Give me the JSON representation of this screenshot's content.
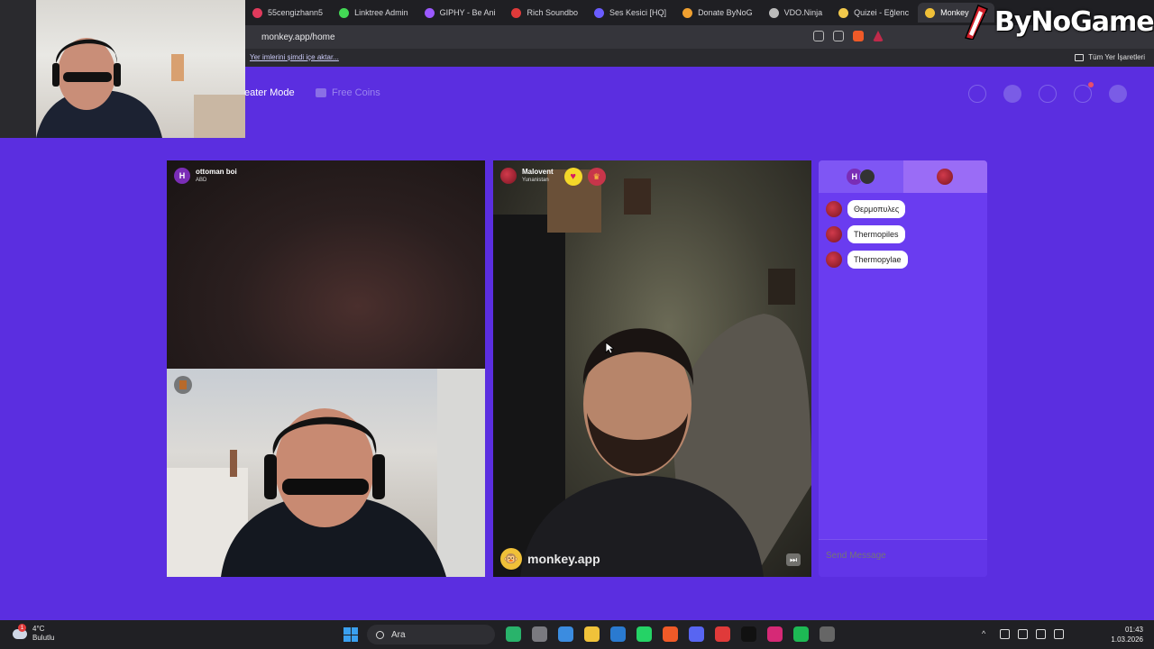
{
  "browser": {
    "tabs": [
      {
        "label": "55cengizhann5",
        "color": "#e03a5c"
      },
      {
        "label": "Linktree Admin",
        "color": "#43d855"
      },
      {
        "label": "GIPHY - Be Ani",
        "color": "#9b59ff"
      },
      {
        "label": "Rich Soundbo",
        "color": "#e03a3a"
      },
      {
        "label": "Ses Kesici [HQ]",
        "color": "#6a5cff"
      },
      {
        "label": "Donate ByNoG",
        "color": "#f0a030"
      },
      {
        "label": "VDO.Ninja",
        "color": "#bbbbbb"
      },
      {
        "label": "Quizei - Eğlenc",
        "color": "#f2c94c"
      },
      {
        "label": "Monkey",
        "color": "#f0c038",
        "active": true
      }
    ],
    "url": "monkey.app/home",
    "bookmark_import": "Yer imlerini şimdi içe aktar...",
    "bookmark_all": "Tüm Yer İşaretleri"
  },
  "brand": {
    "text": "ByNoGame"
  },
  "header": {
    "theater_mode": "eater Mode",
    "free_coins": "Free Coins",
    "icons": [
      "search-icon",
      "avatar-icon",
      "clock-icon",
      "chat-icon",
      "profile-icon"
    ]
  },
  "video": {
    "top": {
      "initial": "H",
      "name": "ottoman boi",
      "country": "ABD"
    },
    "right": {
      "name": "Malovent",
      "country": "Yunanistan"
    },
    "brand_footer": "monkey.app"
  },
  "chat": {
    "tab_left_initial": "H",
    "messages": [
      {
        "text": "Θερμοπυλες"
      },
      {
        "text": "Thermopiles"
      },
      {
        "text": "Thermopylae"
      }
    ],
    "send_placeholder": "Send Message"
  },
  "taskbar": {
    "weather_temp": "4°C",
    "weather_desc": "Bulutlu",
    "weather_badge": "1",
    "search_label": "Ara",
    "time": "01:43",
    "date": "1.03.2026",
    "apps": [
      {
        "icon": "dino-icon",
        "color": "#29b36b"
      },
      {
        "icon": "task-view-icon",
        "color": "#7a7a80"
      },
      {
        "icon": "store-icon",
        "color": "#3b8ce0"
      },
      {
        "icon": "explorer-icon",
        "color": "#f0c23a"
      },
      {
        "icon": "mail-icon",
        "color": "#2a7ad0"
      },
      {
        "icon": "whatsapp-icon",
        "color": "#25d366"
      },
      {
        "icon": "brave-icon",
        "color": "#f05a28"
      },
      {
        "icon": "discord-icon",
        "color": "#5865f2"
      },
      {
        "icon": "app-red-icon",
        "color": "#e03a3a"
      },
      {
        "icon": "tiktok-icon",
        "color": "#111111"
      },
      {
        "icon": "instagram-icon",
        "color": "#d62976"
      },
      {
        "icon": "spotify-icon",
        "color": "#1db954"
      },
      {
        "icon": "app-record-icon",
        "color": "#666666"
      }
    ]
  }
}
